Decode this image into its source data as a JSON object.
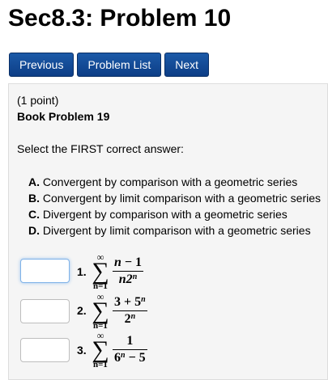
{
  "page": {
    "title": "Sec8.3: Problem 10"
  },
  "nav": {
    "previous": "Previous",
    "problem_list": "Problem List",
    "next": "Next"
  },
  "problem": {
    "points": "(1 point)",
    "book": "Book Problem 19",
    "instruction": "Select the FIRST correct answer:",
    "options": [
      {
        "letter": "A.",
        "text": "Convergent by comparison with a geometric series"
      },
      {
        "letter": "B.",
        "text": "Convergent by limit comparison with a geometric series"
      },
      {
        "letter": "C.",
        "text": "Divergent by comparison with a geometric series"
      },
      {
        "letter": "D.",
        "text": "Divergent by limit comparison with a geometric series"
      }
    ],
    "questions": [
      {
        "number": "1.",
        "lower": "n=1",
        "upper": "∞",
        "num_a": "n",
        "num_b": " − 1",
        "den_a": "n2",
        "den_exp": "n",
        "den_b": "",
        "answer": ""
      },
      {
        "number": "2.",
        "lower": "n=1",
        "upper": "∞",
        "num_a": "3 + 5",
        "num_exp": "n",
        "den_a": "2",
        "den_exp": "n",
        "den_b": "",
        "answer": ""
      },
      {
        "number": "3.",
        "lower": "n=1",
        "upper": "∞",
        "num_a": "1",
        "den_a": "6",
        "den_exp": "n",
        "den_b": " − 5",
        "answer": ""
      }
    ]
  }
}
